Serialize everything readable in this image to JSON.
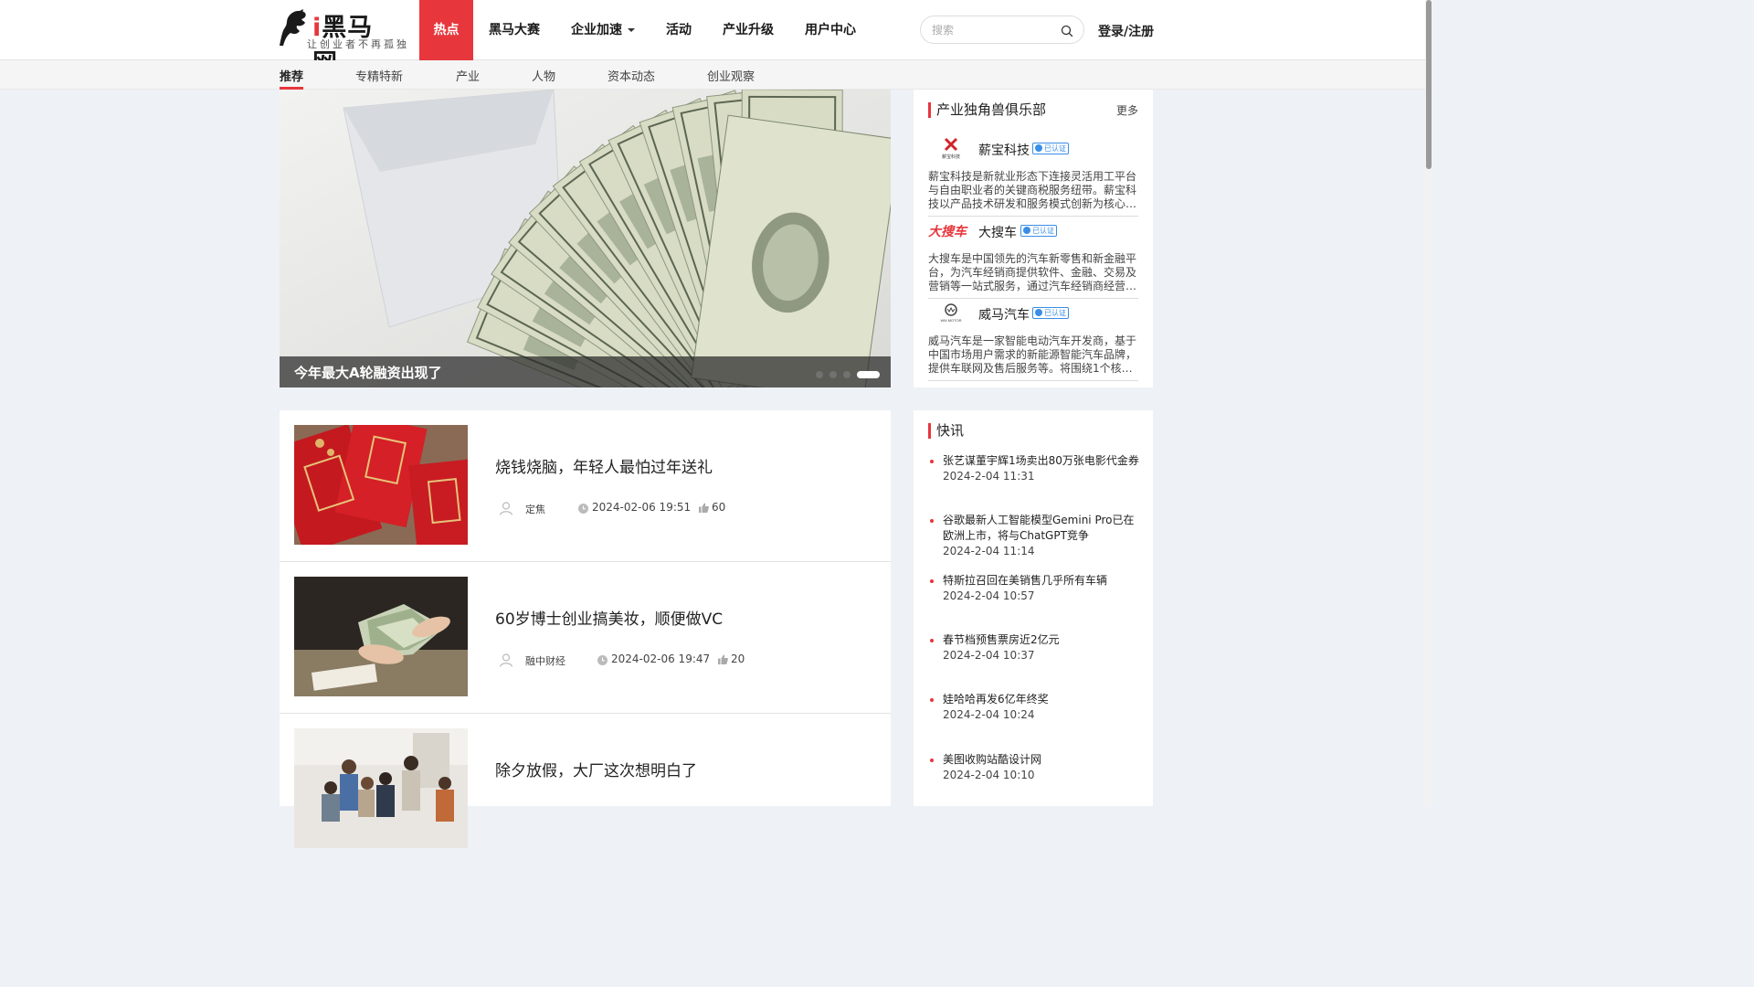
{
  "logo": {
    "i": "i",
    "name": "黑马网",
    "slogan": "让创业者不再孤独"
  },
  "nav": {
    "items": [
      {
        "label": "热点",
        "active": true
      },
      {
        "label": "黑马大赛"
      },
      {
        "label": "企业加速",
        "dropdown": true
      },
      {
        "label": "活动"
      },
      {
        "label": "产业升级"
      },
      {
        "label": "用户中心"
      }
    ]
  },
  "search": {
    "placeholder": "搜索",
    "icon": "search-icon"
  },
  "login": {
    "label": "登录/注册"
  },
  "subnav": {
    "items": [
      {
        "label": "推荐",
        "active": true
      },
      {
        "label": "专精特新"
      },
      {
        "label": "产业"
      },
      {
        "label": "人物"
      },
      {
        "label": "资本动态"
      },
      {
        "label": "创业观察"
      }
    ]
  },
  "banner": {
    "title": "今年最大A轮融资出现了",
    "slide_count": 4,
    "active_slide": 4
  },
  "unicorn": {
    "heading": "产业独角兽俱乐部",
    "more": "更多",
    "verified_label": "已认证",
    "companies": [
      {
        "name": "薪宝科技",
        "logo_text": "薪宝科技",
        "desc": "薪宝科技是新就业形态下连接灵活用工平台与自由职业者的关键商税服务纽带。薪宝科技以产品技术研发和服务模式创新为核心驱动力，为企业提供合规的灵活用工服务。"
      },
      {
        "name": "大搜车",
        "logo_text": "大搜车",
        "desc": "大搜车是中国领先的汽车新零售和新金融平台，为汽车经销商提供软件、金融、交易及营销等一站式服务，通过汽车经销商经营管理及数字化工具赋能行业。"
      },
      {
        "name": "威马汽车",
        "logo_text": "WM MOTOR",
        "desc": "威马汽车是一家智能电动汽车开发商，基于中国市场用户需求的新能源智能汽车品牌，提供车联网及售后服务等。将围绕1个核心架构打造智能出行生态。"
      }
    ]
  },
  "flash": {
    "heading": "快讯",
    "items": [
      {
        "text": "张艺谋董宇辉1场卖出80万张电影代金券",
        "time": "2024-2-04 11:31"
      },
      {
        "text": "谷歌最新人工智能模型Gemini Pro已在欧洲上市，将与ChatGPT竞争",
        "time": "2024-2-04 11:14"
      },
      {
        "text": "特斯拉召回在美销售几乎所有车辆",
        "time": "2024-2-04 10:57"
      },
      {
        "text": "春节档预售票房近2亿元",
        "time": "2024-2-04 10:37"
      },
      {
        "text": "娃哈哈再发6亿年终奖",
        "time": "2024-2-04 10:24"
      },
      {
        "text": "美图收购站酷设计网",
        "time": "2024-2-04 10:10"
      }
    ]
  },
  "articles": [
    {
      "title": "烧钱烧脑，年轻人最怕过年送礼",
      "author": "定焦",
      "date": "2024-02-06 19:51",
      "likes": "60"
    },
    {
      "title": "60岁博士创业搞美妆，顺便做VC",
      "author": "融中财经",
      "date": "2024-02-06 19:47",
      "likes": "20"
    },
    {
      "title": "除夕放假，大厂这次想明白了",
      "author": "",
      "date": "",
      "likes": ""
    }
  ],
  "colors": {
    "accent": "#e8363d",
    "verified": "#3a8ee6",
    "page_bg": "#eef1f6"
  }
}
